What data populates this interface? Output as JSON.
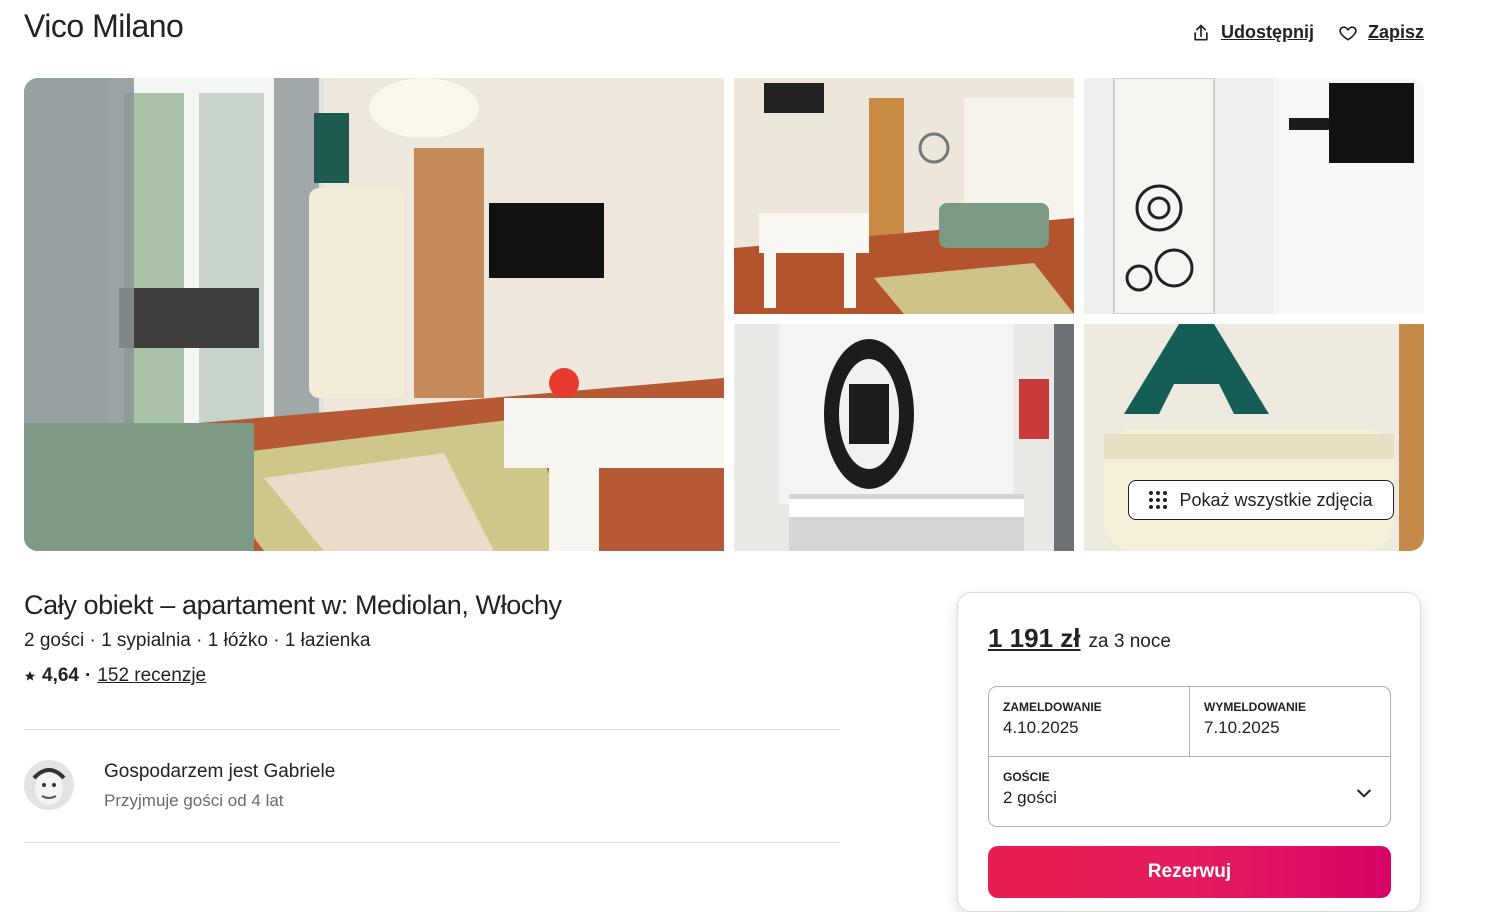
{
  "listing": {
    "title": "Vico Milano",
    "share_label": "Udostępnij",
    "save_label": "Zapisz",
    "show_all_photos": "Pokaż wszystkie zdjęcia",
    "subtitle": "Cały obiekt – apartament w: Mediolan, Włochy",
    "specs": "2 gości · 1 sypialnia · 1 łóżko · 1 łazienka",
    "rating": "4,64",
    "rating_separator": "·",
    "reviews": "152 recenzje",
    "icons": {
      "share": "share-icon",
      "save": "heart-icon",
      "star": "star-icon",
      "grid": "grid-dots-icon",
      "chevron": "chevron-down-icon"
    }
  },
  "host": {
    "name": "Gospodarzem jest Gabriele",
    "since": "Przyjmuje gości od 4 lat"
  },
  "booking": {
    "price": "1 191 zł",
    "price_suffix": "za 3 noce",
    "checkin_label": "ZAMELDOWANIE",
    "checkin_value": "4.10.2025",
    "checkout_label": "WYMELDOWANIE",
    "checkout_value": "7.10.2025",
    "guests_label": "GOŚCIE",
    "guests_value": "2 gości",
    "reserve_label": "Rezerwuj"
  },
  "colors": {
    "brand": "#e31c5f",
    "text": "#222222",
    "muted": "#6a6a6a",
    "border": "#dddddd"
  }
}
